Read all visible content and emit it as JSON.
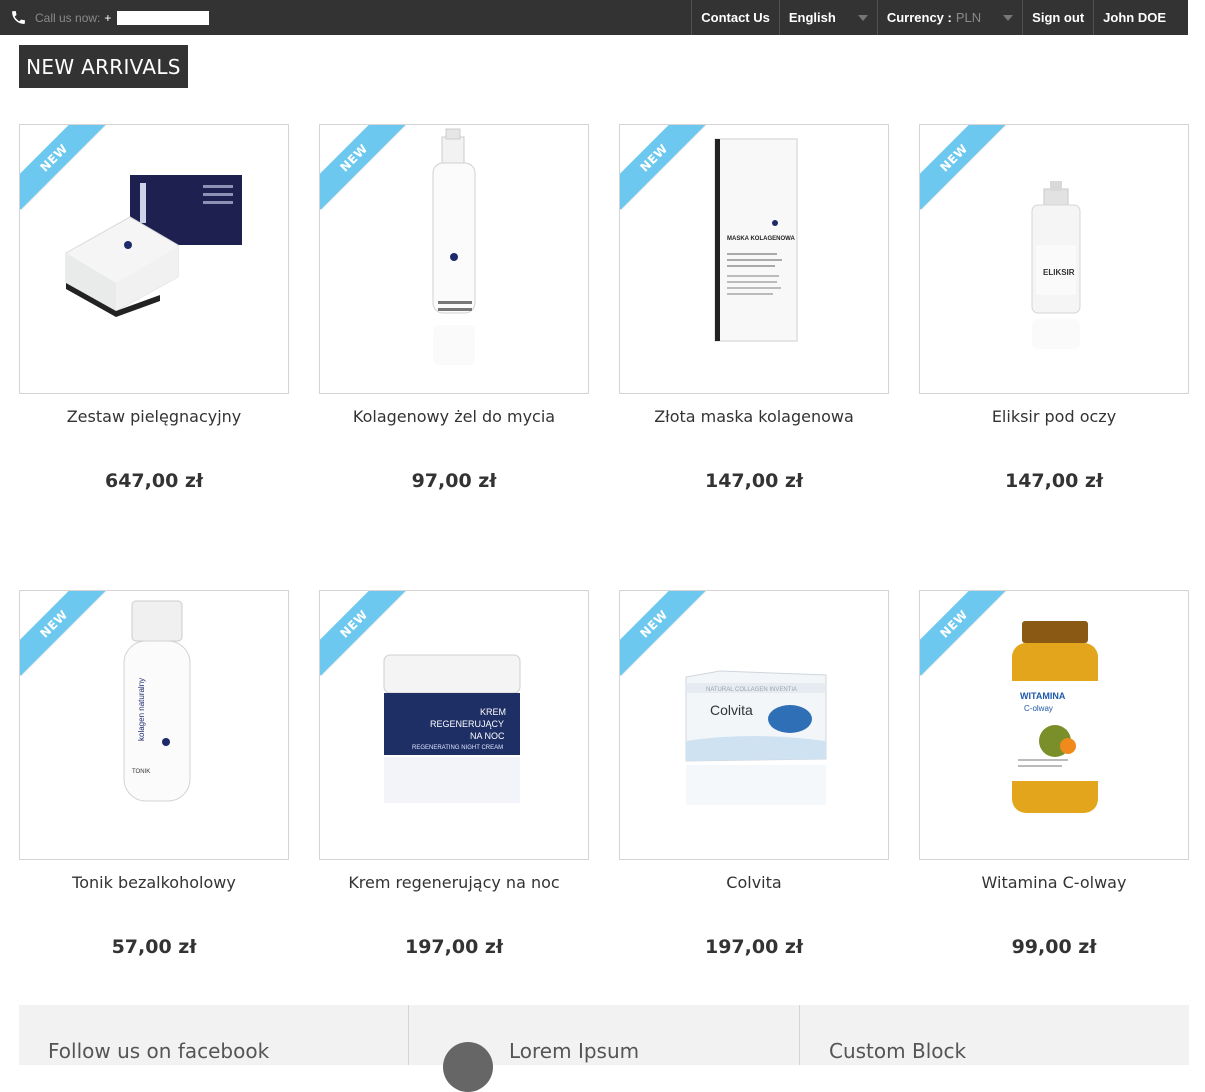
{
  "header": {
    "call_label": "Call us now:",
    "call_number": "+",
    "nav": {
      "contact": "Contact Us",
      "language": "English",
      "currency_label": "Currency :",
      "currency_value": "PLN",
      "signout": "Sign out",
      "user": "John DOE"
    }
  },
  "section_title": "NEW ARRIVALS",
  "badge_label": "NEW",
  "products": [
    {
      "name": "Zestaw pielęgnacyjny",
      "price": "647,00 zł"
    },
    {
      "name": "Kolagenowy żel do mycia",
      "price": "97,00 zł"
    },
    {
      "name": "Złota maska kolagenowa",
      "price": "147,00 zł"
    },
    {
      "name": "Eliksir pod oczy",
      "price": "147,00 zł"
    },
    {
      "name": "Tonik bezalkoholowy",
      "price": "57,00 zł"
    },
    {
      "name": "Krem regenerujący na noc",
      "price": "197,00 zł"
    },
    {
      "name": "Colvita",
      "price": "197,00 zł"
    },
    {
      "name": "Witamina C-olway",
      "price": "99,00 zł"
    }
  ],
  "product_image_text": {
    "mask_title": "MASKA KOLAGENOWA",
    "eliksir": "ELIKSIR",
    "krem_1": "KREM",
    "krem_2": "REGENERUJĄCY",
    "krem_3": "NA NOC",
    "krem_en": "REGENERATING NIGHT CREAM",
    "colvita": "Colvita",
    "colvita_brand": "NATURAL COLLAGEN INVENTIA",
    "witamina": "WITAMINA",
    "colway": "C-olway",
    "bottle_brand": "kolagen naturalny",
    "tonik": "TONIK"
  },
  "footer": {
    "col1": "Follow us on facebook",
    "col2": "Lorem Ipsum",
    "col3": "Custom Block"
  },
  "colors": {
    "dark_bar": "#333333",
    "ribbon": "#6cc8ef"
  }
}
